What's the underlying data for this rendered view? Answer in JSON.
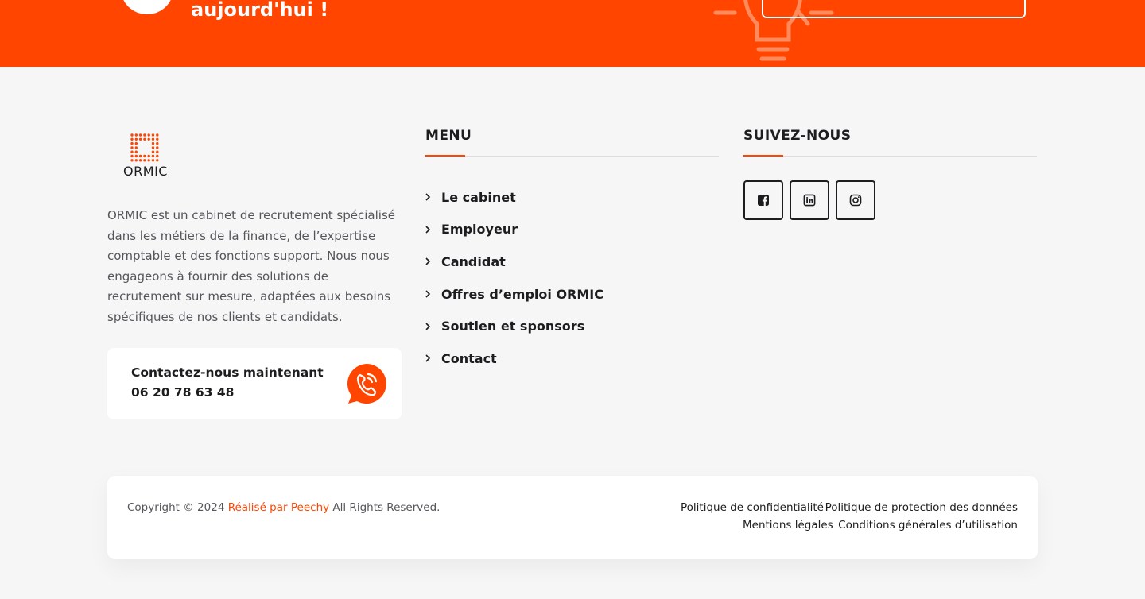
{
  "banner": {
    "title": "aujourd'hui !",
    "background": "#ff4500"
  },
  "brand": {
    "logo_text": "ORMIC",
    "accent": "#ff4500",
    "description": "ORMIC est un cabinet de recrutement spécialisé dans les métiers de la finance, de l’expertise comptable et des fonctions support. Nous nous engageons à fournir des solutions de recrutement sur mesure, adaptées aux besoins spécifiques de nos clients et candidats."
  },
  "contact": {
    "title": "Contactez-nous maintenant",
    "phone": "06 20 78 63 48",
    "icon": "phone-icon"
  },
  "menu": {
    "title": "MENU",
    "items": [
      {
        "label": "Le cabinet"
      },
      {
        "label": "Employeur"
      },
      {
        "label": "Candidat"
      },
      {
        "label": "Offres d’emploi ORMIC"
      },
      {
        "label": "Soutien et sponsors"
      },
      {
        "label": "Contact"
      }
    ]
  },
  "social": {
    "title": "SUIVEZ-NOUS",
    "links": [
      {
        "icon": "facebook-icon"
      },
      {
        "icon": "linkedin-icon"
      },
      {
        "icon": "instagram-icon"
      }
    ]
  },
  "footer": {
    "copyright_prefix": "Copyright © 2024",
    "credit": "Réalisé par Peechy",
    "copyright_suffix": "All Rights Reserved.",
    "links": [
      "Politique de confidentialité",
      "Politique de protection des données",
      "Mentions légales",
      "Conditions générales d’utilisation"
    ]
  }
}
